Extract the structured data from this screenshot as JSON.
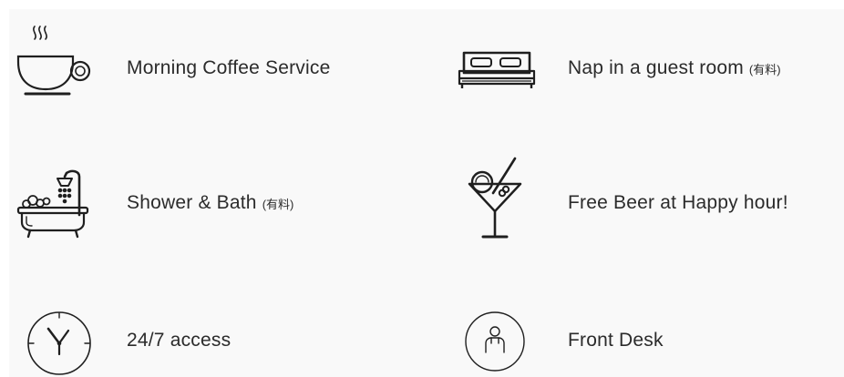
{
  "amenities": {
    "coffee": {
      "label": "Morning Coffee Service",
      "note": "",
      "icon": "coffee-cup-icon"
    },
    "nap": {
      "label": "Nap in a  guest room",
      "note": "(有料)",
      "icon": "bed-icon"
    },
    "shower": {
      "label": "Shower & Bath",
      "note": "(有料)",
      "icon": "bathtub-icon"
    },
    "beer": {
      "label": "Free Beer at Happy hour!",
      "note": "",
      "icon": "cocktail-icon"
    },
    "access": {
      "label": "24/7 access",
      "note": "",
      "icon": "clock-icon"
    },
    "desk": {
      "label": "Front Desk",
      "note": "",
      "icon": "person-icon"
    }
  },
  "colors": {
    "background": "#f9f9f9",
    "text": "#2b2b2b",
    "icon_stroke": "#1f1f1f"
  }
}
